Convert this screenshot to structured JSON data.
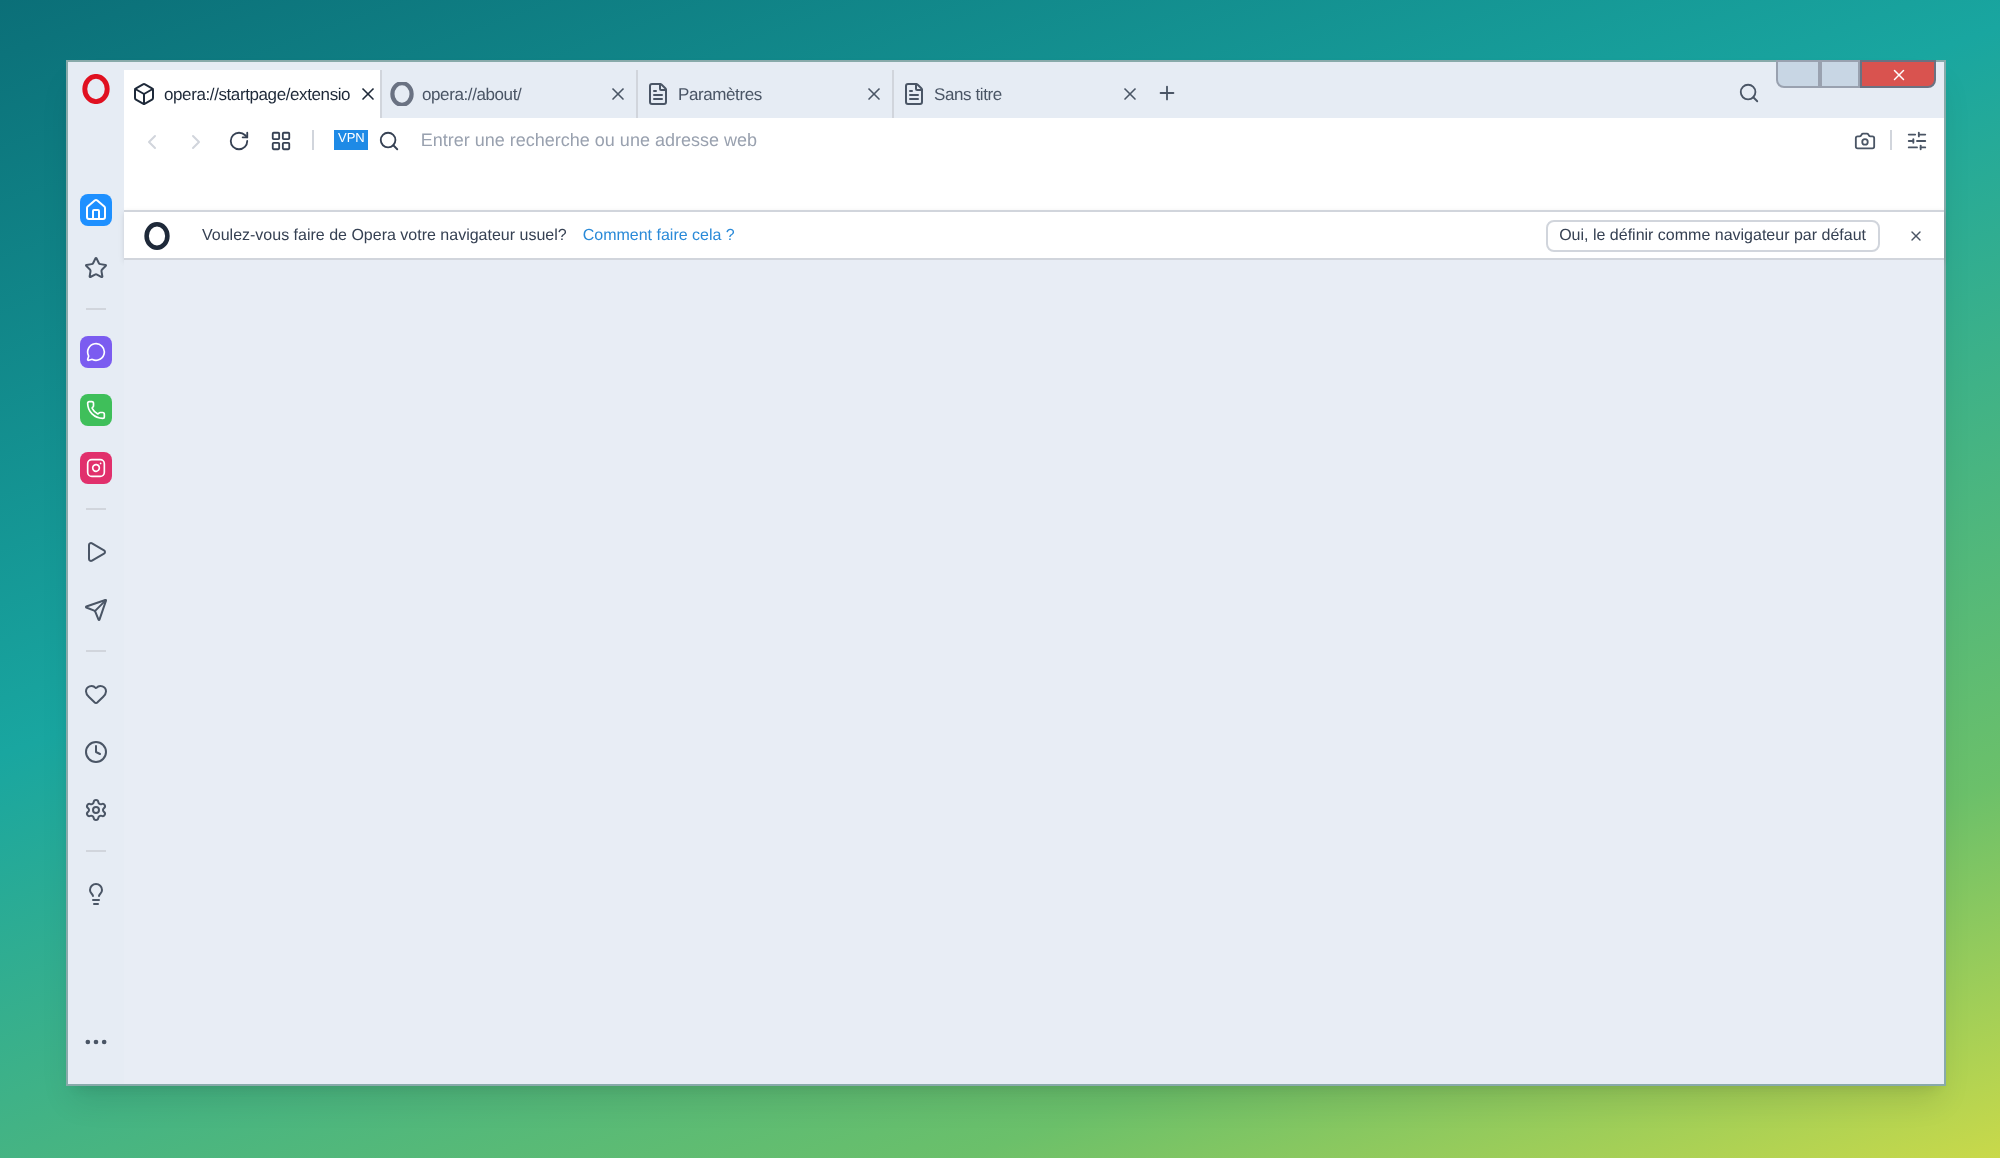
{
  "tabs": [
    {
      "title": "opera://startpage/extensio",
      "selected": true
    },
    {
      "title": "opera://about/",
      "selected": false
    },
    {
      "title": "Paramètres",
      "selected": false
    },
    {
      "title": "Sans titre",
      "selected": false
    }
  ],
  "address_bar": {
    "vpn_badge": "VPN",
    "placeholder": "Entrer une recherche ou une adresse web"
  },
  "sidebar": {
    "groups": [
      [
        {
          "selected": true
        },
        {
          "selected": false
        }
      ],
      [
        {
          "selected": false
        },
        {
          "selected": false
        },
        {
          "selected": false
        }
      ],
      [
        {
          "selected": false
        },
        {
          "selected": false
        }
      ],
      [
        {
          "selected": false
        },
        {
          "selected": false
        },
        {
          "selected": false
        }
      ],
      [
        {
          "selected": false
        }
      ]
    ]
  },
  "notification": {
    "message": "Voulez-vous faire de Opera votre navigateur usuel?",
    "link": "Comment faire cela ?",
    "button": "Oui, le définir comme navigateur par défaut"
  }
}
